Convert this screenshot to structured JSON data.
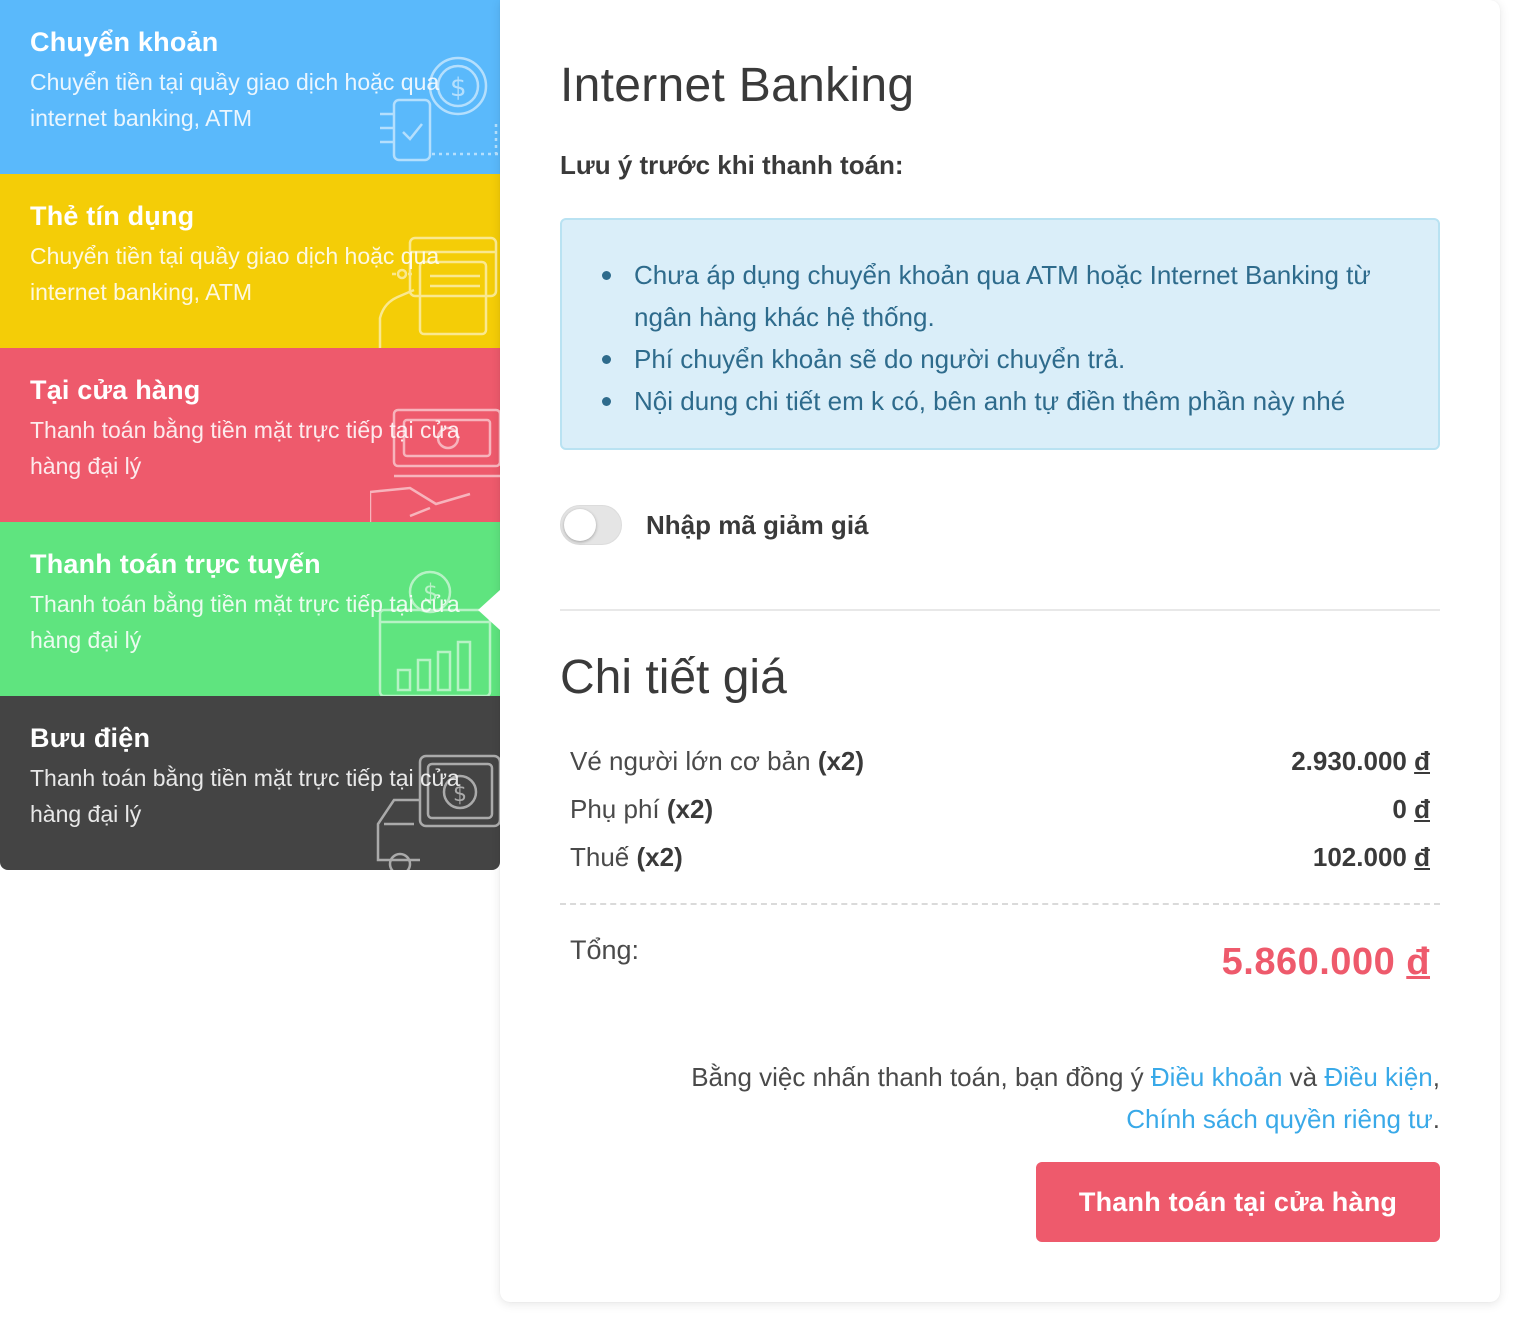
{
  "methods": [
    {
      "title": "Chuyển khoản",
      "desc": "Chuyển tiền tại quầy giao dịch hoặc qua internet banking, ATM",
      "color": "#5ab9fb",
      "icon": "phone-payment-icon"
    },
    {
      "title": "Thẻ tín dụng",
      "desc": "Chuyển tiền tại quầy giao dịch hoặc qua internet banking, ATM",
      "color": "#f4cd07",
      "icon": "credit-card-icon"
    },
    {
      "title": "Tại cửa hàng",
      "desc": "Thanh toán bằng tiền mặt trực tiếp tại cửa hàng đại lý",
      "color": "#ee5a6c",
      "icon": "cash-hand-icon"
    },
    {
      "title": "Thanh toán trực tuyến",
      "desc": "Thanh toán bằng tiền mặt trực tiếp tại cửa hàng đại lý",
      "color": "#5fe47f",
      "icon": "online-payment-icon",
      "active": true
    },
    {
      "title": "Bưu điện",
      "desc": "Thanh toán bằng tiền mặt trực tiếp tại cửa hàng đại lý",
      "color": "#444444",
      "icon": "delivery-truck-icon"
    }
  ],
  "panel": {
    "title": "Internet Banking",
    "note_heading": "Lưu ý trước khi thanh toán:",
    "notes": [
      "Chưa áp dụng chuyển khoản qua ATM hoặc Internet Banking từ ngân hàng khác hệ thống.",
      "Phí chuyển khoản sẽ do người chuyển trả.",
      "Nội dung chi tiết em k có, bên anh tự điền thêm phần này nhé"
    ],
    "promo": {
      "label": "Nhập mã giảm giá",
      "enabled": false
    }
  },
  "price": {
    "title": "Chi tiết giá",
    "rows": [
      {
        "label": "Vé người lớn cơ bản",
        "qty": "(x2)",
        "amount": "2.930.000",
        "currency": "đ"
      },
      {
        "label": "Phụ phí",
        "qty": "(x2)",
        "amount": "0",
        "currency": "đ"
      },
      {
        "label": "Thuế",
        "qty": "(x2)",
        "amount": "102.000",
        "currency": "đ"
      }
    ],
    "total_label": "Tổng:",
    "total_amount": "5.860.000",
    "total_currency": "đ"
  },
  "terms": {
    "prefix": "Bằng việc nhấn thanh toán, bạn đồng ý ",
    "link1": "Điều khoản",
    "and": " và ",
    "link2": "Điều kiện",
    "comma": ",",
    "link3": "Chính sách quyền riêng tư",
    "period": "."
  },
  "pay_button": "Thanh toán tại cửa hàng",
  "colors": {
    "accent_red": "#ee5a6c",
    "link_blue": "#39a9e8",
    "note_text": "#2e6b8c"
  }
}
